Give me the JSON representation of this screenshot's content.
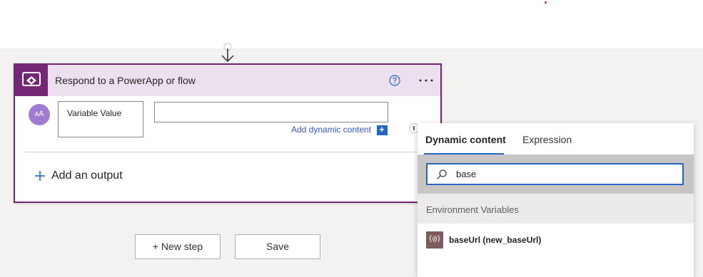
{
  "card": {
    "title": "Respond to a PowerApp or flow",
    "icon": "powerapps-icon",
    "help_icon": "help-icon",
    "more_icon": "more-options-icon",
    "accent_color": "#742774",
    "header_color": "#ede0ee",
    "output_row": {
      "avatar_text": "ᴀA",
      "name": "Variable Value",
      "value": "",
      "add_dynamic_label": "Add dynamic content",
      "add_dynamic_plus": "+"
    },
    "add_output_plus": "+",
    "add_output_label": "Add an output"
  },
  "footer": {
    "new_step_label": "+ New step",
    "save_label": "Save"
  },
  "panel": {
    "tabs": [
      {
        "label": "Dynamic content",
        "active": true
      },
      {
        "label": "Expression",
        "active": false
      }
    ],
    "search": {
      "value": "base",
      "icon": "search-icon"
    },
    "section_title": "Environment Variables",
    "results": [
      {
        "icon_text": "{@}",
        "label": "baseUrl (new_baseUrl)"
      }
    ],
    "accent_color": "#2866c4"
  }
}
